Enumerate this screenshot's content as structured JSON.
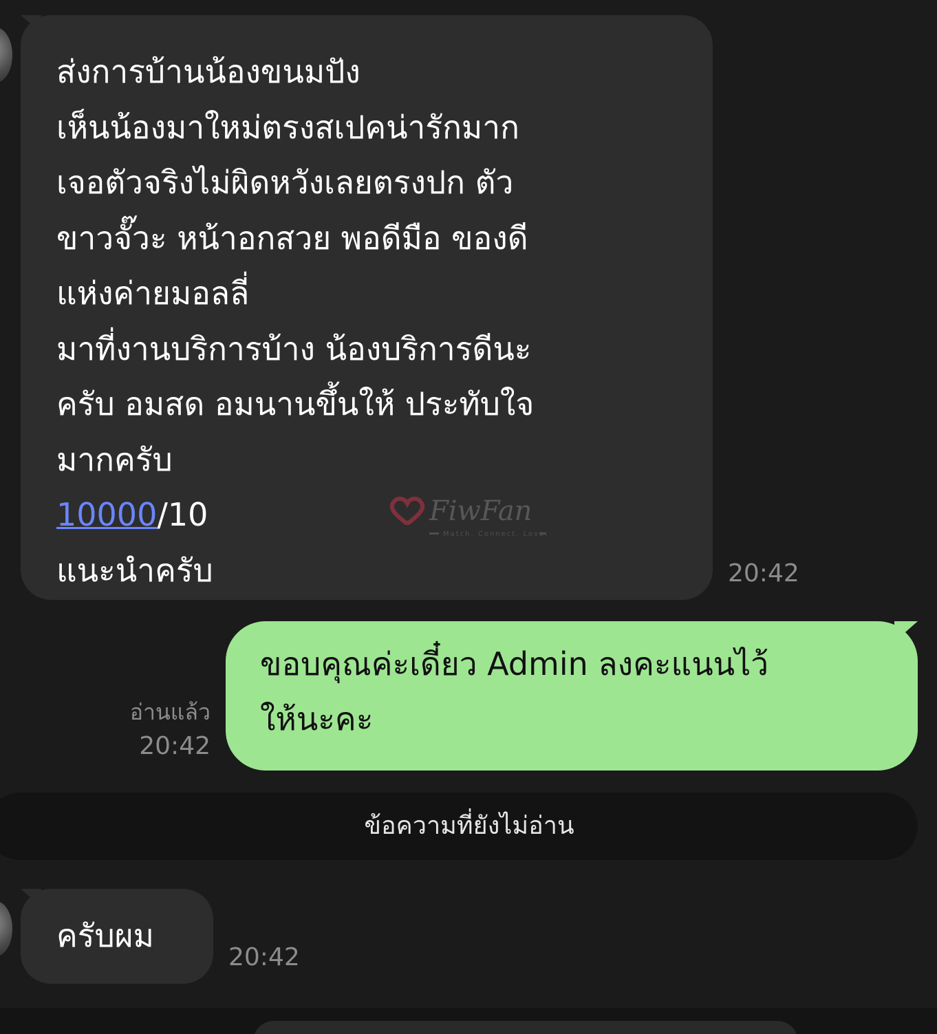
{
  "chat": {
    "messages": [
      {
        "direction": "incoming",
        "lines": [
          "ส่งการบ้านน้องขนมปัง",
          "เห็นน้องมาใหม่ตรงสเปคน่ารักมาก",
          "เจอตัวจริงไม่ผิดหวังเลยตรงปก ตัว",
          "ขาวจั๊วะ หน้าอกสวย พอดีมือ ของดี",
          "แห่งค่ายมอลลี่",
          "มาที่งานบริการบ้าง น้องบริการดีนะ",
          "ครับ อมสด อมนานขึ้นให้ ประทับใจ",
          "มากครับ"
        ],
        "score_link": "10000",
        "score_suffix": "/10",
        "last_line": "แนะนำครับ",
        "time": "20:42"
      },
      {
        "direction": "outgoing",
        "lines": [
          "ขอบคุณค่ะเดี๋ยว Admin ลงคะแนนไว้",
          "ให้นะคะ"
        ],
        "read_label": "อ่านแล้ว",
        "time": "20:42"
      },
      {
        "direction": "incoming",
        "text": "ครับผม",
        "time": "20:42"
      }
    ],
    "unread_divider": "ข้อความที่ยังไม่อ่าน"
  },
  "watermark": {
    "brand": "FiwFan",
    "tagline": "Match. Connect. Love."
  },
  "colors": {
    "background": "#1b1b1b",
    "incoming_bubble": "#2d2d2d",
    "outgoing_bubble": "#9ee592",
    "link": "#6a86ff",
    "timestamp": "#8c8c8c",
    "watermark": "#c2334a"
  }
}
